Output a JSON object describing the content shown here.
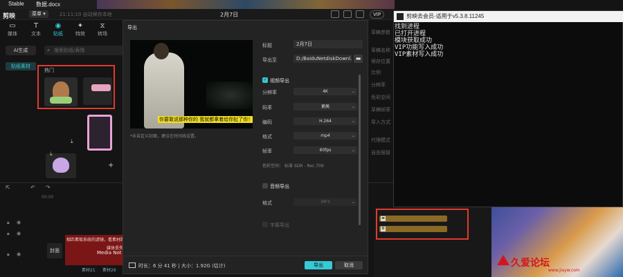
{
  "taskbar": {
    "items": [
      "Stable",
      "数据.docx"
    ]
  },
  "titlebar": {
    "app_logo": "剪映",
    "menu_label": "菜单 ▾",
    "autosave": "21:11:10 自动保存本地",
    "doc_title": "2月7日",
    "vip_label": "VIP"
  },
  "toolbar": {
    "tools": [
      "媒体",
      "文本",
      "贴纸",
      "特效",
      "转场"
    ]
  },
  "assets": {
    "ai_button": "AI生成",
    "search_placeholder": "搜索贴纸/表情",
    "side_tab": "贴纸素材",
    "category": "热门"
  },
  "export_dialog": {
    "title": "导出",
    "cover_note": "*未自定义封面，建议在时间线设置。",
    "name_label": "标题",
    "name_value": "2月7日",
    "path_label": "导出至",
    "path_value": "D:/BaiduNetdiskDownl...",
    "video_section": "视频导出",
    "fields": [
      {
        "label": "分辨率",
        "value": "4K"
      },
      {
        "label": "码率",
        "value": "更高"
      },
      {
        "label": "编码",
        "value": "H.264"
      },
      {
        "label": "格式",
        "value": "mp4"
      },
      {
        "label": "帧率",
        "value": "60fps"
      }
    ],
    "color_space": "色彩空间： 标准 SDR - Rec.709",
    "audio_section": "音频导出",
    "audio_format_label": "格式",
    "audio_format_value": "MP3",
    "subtitle_section": "字幕导出",
    "preview_subtitle": "你要敢说那种你的 我就都拿着给你扯了你！",
    "footer_info": "时长：6 分 41 秒 | 大小：1.92G (估计)",
    "export_button": "导出",
    "cancel_button": "取消"
  },
  "console": {
    "title": "剪映去会员-适用于v5.3.8.11245",
    "lines": [
      "找到进程",
      "已打开进程",
      "模块获取成功",
      "VIP功能写入成功",
      "VIP素材写入成功"
    ]
  },
  "timeline": {
    "cover_label": "封面",
    "clip_text_1": "相匹素取系统的滤镜，看素材路径是否…",
    "clip_text_2": "媒体丢失",
    "media_not_found": "Media Not F",
    "clip_tags": [
      "素材21",
      "素材26"
    ],
    "ruler_mark": "00:00"
  },
  "properties": {
    "items": [
      "草稿参数",
      "草稿名称",
      "保存位置",
      "比例",
      "分辨率",
      "色彩空间",
      "草稿帧率",
      "导入方式",
      "代理模式",
      "自由层级"
    ]
  },
  "watermark": {
    "text": "久爱论坛",
    "url": "www.jiayw.com"
  },
  "colors": {
    "accent": "#36c9d6",
    "highlight_box": "#e23a2f",
    "clip_red": "#7a1616",
    "gold_track": "#8a6a24"
  }
}
